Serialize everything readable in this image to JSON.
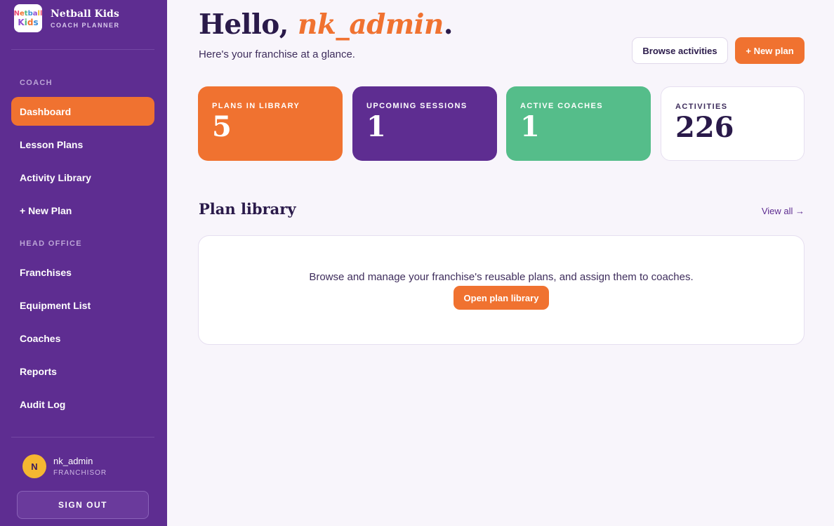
{
  "brand": {
    "logo_line1": "Netball",
    "logo_line2": "Kids",
    "name": "Netball Kids",
    "subtitle": "COACH PLANNER"
  },
  "sidebar": {
    "coach_section": "COACH",
    "coach_items": [
      {
        "label": "Dashboard",
        "active": true
      },
      {
        "label": "Lesson Plans"
      },
      {
        "label": "Activity Library"
      },
      {
        "label": "+ New Plan"
      }
    ],
    "head_office_section": "HEAD OFFICE",
    "head_office_items": [
      {
        "label": "Franchises"
      },
      {
        "label": "Equipment List"
      },
      {
        "label": "Coaches"
      },
      {
        "label": "Reports"
      },
      {
        "label": "Audit Log"
      }
    ],
    "user": {
      "initial": "N",
      "name": "nk_admin",
      "role": "FRANCHISOR"
    },
    "sign_out": "SIGN OUT"
  },
  "header": {
    "greeting_prefix": "Hello, ",
    "username": "nk_admin",
    "greeting_suffix": ".",
    "subtitle": "Here's your franchise at a glance.",
    "browse_button": "Browse activities",
    "new_plan_button": "+ New plan"
  },
  "stats": [
    {
      "label": "PLANS IN LIBRARY",
      "value": "5"
    },
    {
      "label": "UPCOMING SESSIONS",
      "value": "1"
    },
    {
      "label": "ACTIVE COACHES",
      "value": "1"
    },
    {
      "label": "ACTIVITIES",
      "value": "226"
    }
  ],
  "plan_library": {
    "title": "Plan library",
    "view_all": "View all →",
    "description": "Browse and manage your franchise's reusable plans, and assign them to coaches.",
    "open_button": "Open plan library"
  },
  "colors": {
    "sidebar": "#5e2d91",
    "accent_orange": "#f07230",
    "accent_green": "#55bd8a",
    "background": "#f8f5fb"
  }
}
